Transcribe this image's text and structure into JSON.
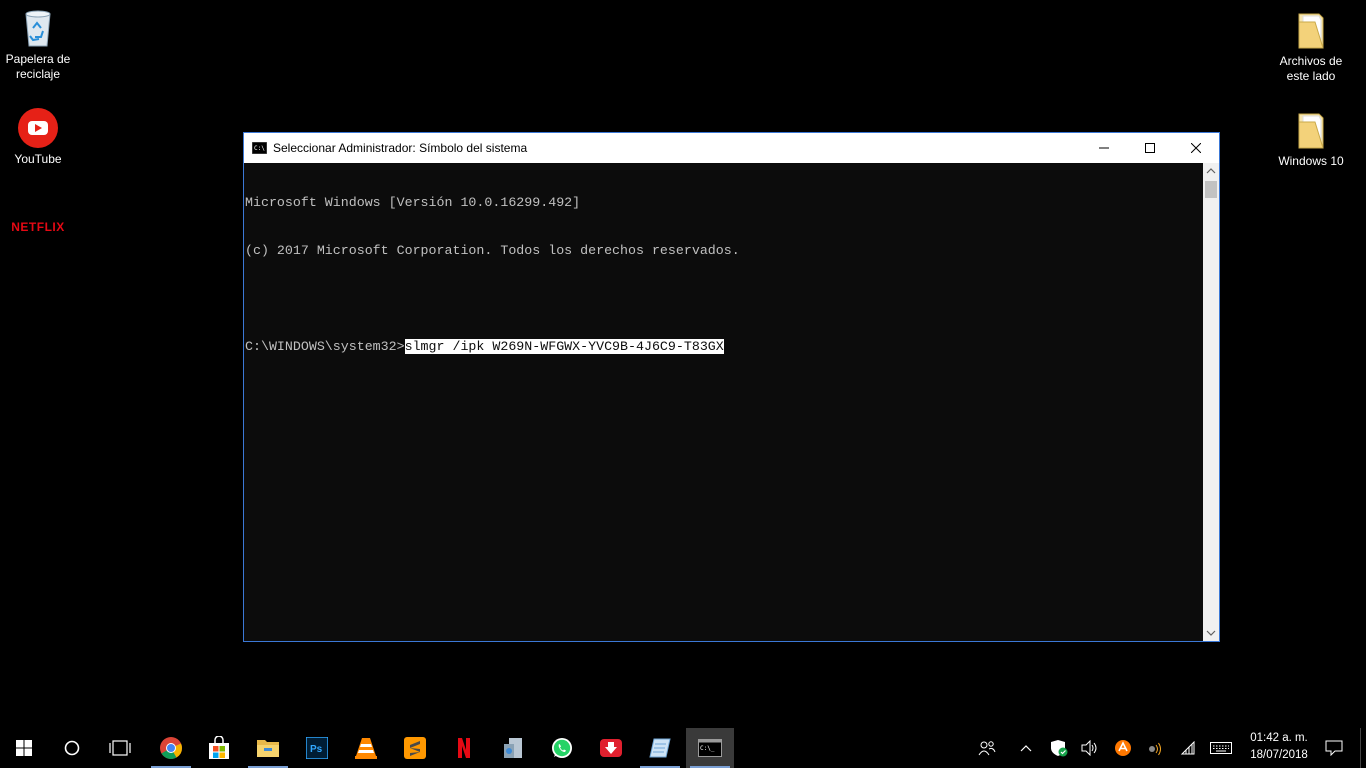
{
  "desktop": {
    "icons_left": [
      {
        "label": "Papelera de reciclaje",
        "icon": "recycle-bin-icon"
      },
      {
        "label": "YouTube",
        "icon": "youtube-icon"
      },
      {
        "label": "NETFLIX",
        "icon": "netflix-icon"
      }
    ],
    "icons_right": [
      {
        "label": "Archivos de este lado",
        "icon": "folder-icon"
      },
      {
        "label": "Windows 10",
        "icon": "folder-icon"
      }
    ]
  },
  "window": {
    "title": "Seleccionar Administrador: Símbolo del sistema",
    "console_lines": [
      "Microsoft Windows [Versión 10.0.16299.492]",
      "(c) 2017 Microsoft Corporation. Todos los derechos reservados.",
      "",
      "C:\\WINDOWS\\system32>"
    ],
    "selected_command": "slmgr /ipk W269N-WFGWX-YVC9B-4J6C9-T83GX",
    "colors": {
      "background": "#0c0c0c",
      "text": "#c0c0c0",
      "border": "#3b78d6"
    }
  },
  "taskbar": {
    "apps": [
      "start",
      "cortana",
      "task-view",
      "chrome",
      "store",
      "file-explorer",
      "photoshop",
      "vlc",
      "sublime-text",
      "netflix",
      "installer",
      "whatsapp",
      "downloader",
      "notepad",
      "command-prompt"
    ],
    "clock": {
      "time": "01:42 a. m.",
      "date": "18/07/2018"
    }
  }
}
